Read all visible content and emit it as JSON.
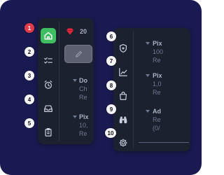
{
  "left_sidebar": {
    "badges": [
      "1",
      "2",
      "3",
      "4",
      "5"
    ],
    "items": [
      {
        "icon": "home-icon"
      },
      {
        "icon": "checklist-icon"
      },
      {
        "icon": "alarm-clock-icon"
      },
      {
        "icon": "inbox-tray-icon"
      },
      {
        "icon": "clipboard-icon"
      }
    ]
  },
  "left_content": {
    "gem_value": "20",
    "groups": [
      {
        "lines": [
          "Do",
          "Ch",
          "Re"
        ]
      },
      {
        "lines": [
          "Pix",
          "10,",
          "Re"
        ]
      }
    ]
  },
  "right_sidebar": {
    "badges": [
      "6",
      "7",
      "8",
      "9",
      "10"
    ],
    "items": [
      {
        "icon": "shield-icon"
      },
      {
        "icon": "chart-up-icon"
      },
      {
        "icon": "shopping-bag-icon"
      },
      {
        "icon": "binoculars-icon"
      },
      {
        "icon": "gear-icon"
      }
    ]
  },
  "right_content": {
    "groups": [
      {
        "lines": [
          "Pix",
          "100",
          "Re"
        ]
      },
      {
        "lines": [
          "Pix",
          "1,0",
          "Re"
        ]
      },
      {
        "lines": [
          "Pix",
          "1,0",
          "Re"
        ]
      },
      {
        "lines": [
          "Ad",
          "Re",
          "(0/"
        ]
      }
    ]
  },
  "colors": {
    "background": "#1a1a52",
    "panel": "#1c2130",
    "active_green": "#3fbf62",
    "badge_red": "#e23a4a",
    "gem_red": "#e0263b"
  }
}
